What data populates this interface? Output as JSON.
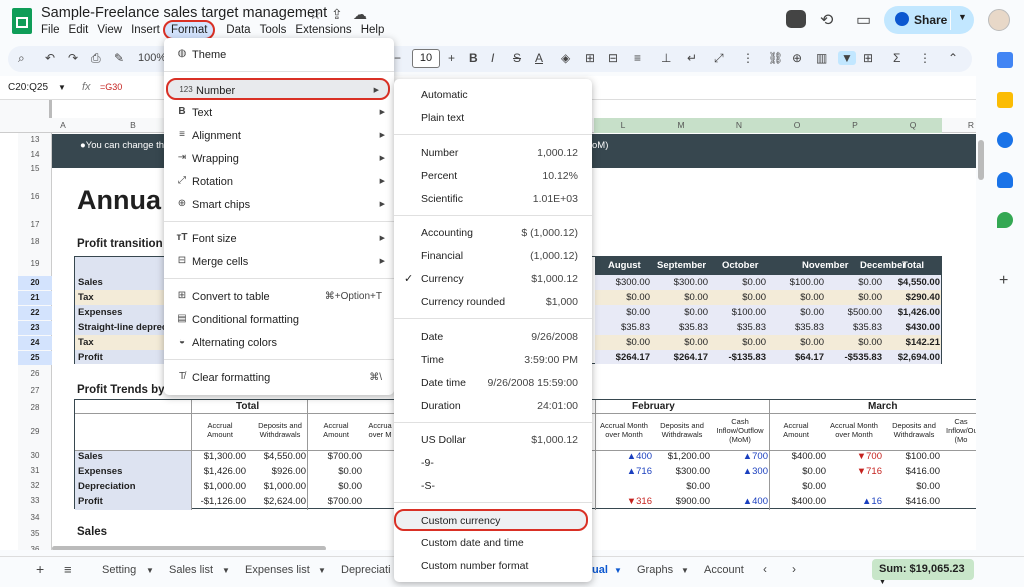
{
  "doc_title": "Sample-Freelance sales target management",
  "menu": [
    "File",
    "Edit",
    "View",
    "Insert",
    "Format",
    "Data",
    "Tools",
    "Extensions",
    "Help"
  ],
  "share_label": "Share",
  "toolbar": {
    "zoom": "100%",
    "font_size": "10"
  },
  "formula_bar": {
    "name_box": "C20:Q25",
    "fx": "fx",
    "formula": "=G30"
  },
  "columns": [
    {
      "label": "A",
      "selected": false
    },
    {
      "label": "B",
      "selected": false
    },
    {
      "label": "L",
      "selected": true
    },
    {
      "label": "M",
      "selected": true
    },
    {
      "label": "N",
      "selected": true
    },
    {
      "label": "O",
      "selected": true
    },
    {
      "label": "P",
      "selected": true
    },
    {
      "label": "Q",
      "selected": true
    },
    {
      "label": "R",
      "selected": false
    }
  ],
  "rows": [
    {
      "n": "13",
      "sel": false
    },
    {
      "n": "14",
      "sel": false
    },
    {
      "n": "15",
      "sel": false
    },
    {
      "n": "16",
      "sel": false
    },
    {
      "n": "17",
      "sel": false
    },
    {
      "n": "18",
      "sel": false
    },
    {
      "n": "19",
      "sel": false
    },
    {
      "n": "20",
      "sel": true
    },
    {
      "n": "21",
      "sel": true
    },
    {
      "n": "22",
      "sel": true
    },
    {
      "n": "23",
      "sel": true
    },
    {
      "n": "24",
      "sel": true
    },
    {
      "n": "25",
      "sel": true
    },
    {
      "n": "26",
      "sel": false
    },
    {
      "n": "27",
      "sel": false
    },
    {
      "n": "28",
      "sel": false
    },
    {
      "n": "29",
      "sel": false
    },
    {
      "n": "30",
      "sel": false
    },
    {
      "n": "31",
      "sel": false
    },
    {
      "n": "32",
      "sel": false
    },
    {
      "n": "33",
      "sel": false
    },
    {
      "n": "34",
      "sel": false
    },
    {
      "n": "35",
      "sel": false
    },
    {
      "n": "36",
      "sel": false
    }
  ],
  "banner_text_left": "●You can change the",
  "banner_text_right": "oM)",
  "annual_title": "Annua",
  "profit_transition_title": "Profit transition",
  "profit_trends_title": "Profit Trends by",
  "sales_title": "Sales",
  "transition_header": [
    "August",
    "September",
    "October",
    "November",
    "December",
    "Total"
  ],
  "transition_rows": [
    {
      "label": "Sales",
      "vals": [
        "$300.00",
        "$300.00",
        "$0.00",
        "$100.00",
        "$0.00",
        "$4,550.00"
      ]
    },
    {
      "label": "Tax",
      "vals": [
        "$0.00",
        "$0.00",
        "$0.00",
        "$0.00",
        "$0.00",
        "$290.40"
      ]
    },
    {
      "label": "Expenses",
      "vals": [
        "$0.00",
        "$0.00",
        "$100.00",
        "$0.00",
        "$500.00",
        "$1,426.00"
      ]
    },
    {
      "label": "Straight-line depreci",
      "vals": [
        "$35.83",
        "$35.83",
        "$35.83",
        "$35.83",
        "$35.83",
        "$430.00"
      ]
    },
    {
      "label": "Tax",
      "vals": [
        "$0.00",
        "$0.00",
        "$0.00",
        "$0.00",
        "$0.00",
        "$142.21"
      ]
    },
    {
      "label": "Profit",
      "vals": [
        "$264.17",
        "$264.17",
        "-$135.83",
        "$64.17",
        "-$535.83",
        "$2,694.00"
      ]
    }
  ],
  "trends": {
    "group_total": "Total",
    "group_february": "February",
    "group_march": "March",
    "sub_headers": {
      "accrual_amount": "Accrual Amount",
      "deposits_withdrawals": "Deposits and Withdrawals",
      "accrual_mom": "Accrual Month over Month",
      "accrual_mom_short": "Accrua over M",
      "cash_inflow": "Cash Inflow/Outflow (MoM)",
      "cash_short": "Cas Inflow/Ou (Mo"
    },
    "rows": [
      {
        "label": "Sales",
        "total_acc": "$1,300.00",
        "total_dep": "$4,550.00",
        "jan_acc": "$700.00",
        "feb_mom": "▲400",
        "feb_dep": "$1,200.00",
        "feb_cash": "▲700",
        "mar_acc": "$400.00",
        "mar_mom": "▼700",
        "mar_dep": "$100.00"
      },
      {
        "label": "Expenses",
        "total_acc": "$1,426.00",
        "total_dep": "$926.00",
        "jan_acc": "$0.00",
        "feb_mom": "▲716",
        "feb_dep": "$300.00",
        "feb_cash": "▲300",
        "mar_acc": "$0.00",
        "mar_mom": "▼716",
        "mar_dep": "$416.00"
      },
      {
        "label": "Depreciation",
        "total_acc": "$1,000.00",
        "total_dep": "$1,000.00",
        "jan_acc": "$0.00",
        "feb_mom": "",
        "feb_dep": "$0.00",
        "feb_cash": "",
        "mar_acc": "$0.00",
        "mar_mom": "",
        "mar_dep": "$0.00"
      },
      {
        "label": "Profit",
        "total_acc": "-$1,126.00",
        "total_dep": "$2,624.00",
        "jan_acc": "$700.00",
        "feb_mom": "▼316",
        "feb_dep": "$900.00",
        "feb_cash": "▲400",
        "mar_acc": "$400.00",
        "mar_mom": "▲16",
        "mar_dep": "$416.00"
      }
    ]
  },
  "format_menu": {
    "theme": "Theme",
    "number": "Number",
    "text": "Text",
    "alignment": "Alignment",
    "wrapping": "Wrapping",
    "rotation": "Rotation",
    "smart_chips": "Smart chips",
    "font_size": "Font size",
    "merge_cells": "Merge cells",
    "convert_to_table": "Convert to table",
    "convert_shortcut": "⌘+Option+T",
    "conditional_formatting": "Conditional formatting",
    "alternating_colors": "Alternating colors",
    "clear_formatting": "Clear formatting",
    "clear_shortcut": "⌘\\"
  },
  "number_menu": {
    "automatic": "Automatic",
    "plain_text": "Plain text",
    "number": {
      "label": "Number",
      "value": "1,000.12"
    },
    "percent": {
      "label": "Percent",
      "value": "10.12%"
    },
    "scientific": {
      "label": "Scientific",
      "value": "1.01E+03"
    },
    "accounting": {
      "label": "Accounting",
      "value": "$ (1,000.12)"
    },
    "financial": {
      "label": "Financial",
      "value": "(1,000.12)"
    },
    "currency": {
      "label": "Currency",
      "value": "$1,000.12"
    },
    "currency_rounded": {
      "label": "Currency rounded",
      "value": "$1,000"
    },
    "date": {
      "label": "Date",
      "value": "9/26/2008"
    },
    "time": {
      "label": "Time",
      "value": "3:59:00 PM"
    },
    "date_time": {
      "label": "Date time",
      "value": "9/26/2008 15:59:00"
    },
    "duration": {
      "label": "Duration",
      "value": "24:01:00"
    },
    "us_dollar": {
      "label": "US Dollar",
      "value": "$1,000.12"
    },
    "neg9": "-9-",
    "negS": "-S-",
    "custom_currency": "Custom currency",
    "custom_date_time": "Custom date and time",
    "custom_number_format": "Custom number format"
  },
  "sheet_tabs": [
    "Setting",
    "Sales list",
    "Expenses list",
    "Depreciati",
    "ual",
    "Graphs",
    "Account"
  ],
  "sum_label": "Sum: $19,065.23"
}
